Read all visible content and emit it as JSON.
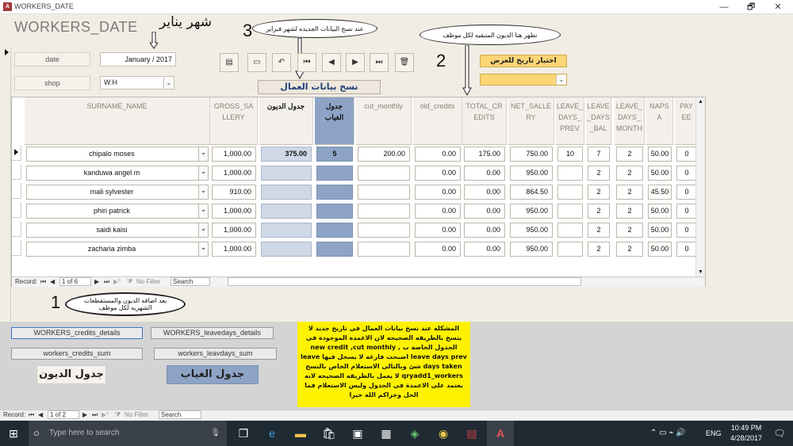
{
  "window": {
    "title": "WORKERS_DATE",
    "minimize": "—",
    "restore": "🗗",
    "close": "✕"
  },
  "header": {
    "app_title": "WORKERS_DATE",
    "month_label_ar": "شهر يناير",
    "num3": "3",
    "num2": "2",
    "num1": "1",
    "callout3": "عند نسخ البيانات الجديده لشهر فبراير",
    "callout2": "تظهر هنا الديون المتبقيه لكل موظف",
    "callout1": "بعد اضافه الديون والمستقطعات الشهريه لكل موظف"
  },
  "form": {
    "date_label": "date",
    "date_value": "January / 2017",
    "shop_label": "shop",
    "shop_value": "W.H",
    "copy_button": "نسخ بيانات العمال",
    "display_date_button": "اختيار تاريخ للعرض",
    "display_date_value": ""
  },
  "nav_icons": [
    "report-icon",
    "print-icon",
    "undo-icon",
    "first-record-icon",
    "previous-record-icon",
    "next-record-icon",
    "last-record-icon",
    "delete-icon"
  ],
  "table": {
    "columns": [
      "SURNAME_NAME",
      "GROSS_SA\nLLERY",
      "جدول الديون",
      "جدول\nالغياب",
      "cut_monthly",
      "old_credits",
      "TOTAL_CR\nEDITS",
      "NET_SALLE\nRY",
      "LEAVE_\nDAYS_\nPREV",
      "LEAVE\n_DAYS\n_BAL",
      "LEAVE_\nDAYS_\nMONTH",
      "NAPS\nA",
      "PAY\nEE"
    ],
    "rows": [
      {
        "name": "chipalo moses",
        "gross": "1,000.00",
        "credits": "375.00",
        "absence": "5",
        "cut": "200.00",
        "old": "0.00",
        "total": "175.00",
        "net": "750.00",
        "prev": "10",
        "bal": "7",
        "month": "2",
        "napsa": "50.00",
        "payee": "0"
      },
      {
        "name": "kanduwa angel m",
        "gross": "1,000.00",
        "credits": "",
        "absence": "",
        "cut": "",
        "old": "0.00",
        "total": "0.00",
        "net": "950.00",
        "prev": "",
        "bal": "2",
        "month": "2",
        "napsa": "50.00",
        "payee": "0"
      },
      {
        "name": "mali sylvester",
        "gross": "910.00",
        "credits": "",
        "absence": "",
        "cut": "",
        "old": "0.00",
        "total": "0.00",
        "net": "864.50",
        "prev": "",
        "bal": "2",
        "month": "2",
        "napsa": "45.50",
        "payee": "0"
      },
      {
        "name": "phiri patrick",
        "gross": "1,000.00",
        "credits": "",
        "absence": "",
        "cut": "",
        "old": "0.00",
        "total": "0.00",
        "net": "950.00",
        "prev": "",
        "bal": "2",
        "month": "2",
        "napsa": "50.00",
        "payee": "0"
      },
      {
        "name": "saidi kaisi",
        "gross": "1,000.00",
        "credits": "",
        "absence": "",
        "cut": "",
        "old": "0.00",
        "total": "0.00",
        "net": "950.00",
        "prev": "",
        "bal": "2",
        "month": "2",
        "napsa": "50.00",
        "payee": "0"
      },
      {
        "name": "zacharia zimba",
        "gross": "1,000.00",
        "credits": "",
        "absence": "",
        "cut": "",
        "old": "0.00",
        "total": "0.00",
        "net": "950.00",
        "prev": "",
        "bal": "2",
        "month": "2",
        "napsa": "50.00",
        "payee": "0"
      }
    ]
  },
  "subnav": {
    "record_label": "Record:",
    "position": "1 of 6",
    "filter": "No Filter",
    "search": "Search"
  },
  "lower": {
    "btn_credits_details": "WORKERS_credits_details",
    "btn_leavedays_details": "WORKERS_leavedays_details",
    "btn_credits_sum": "workers_credits_sum",
    "btn_leavdays_sum": "workers_leavdays_sum",
    "credits_table_ar": "جدول الديون",
    "absence_table_ar": "جدول الغياب",
    "note": "المشكله عند نسخ بيانات العمال فى تاريخ جديد لا ينسخ بالطريقه الصحيحه لان الاعمده الموجودة فى الجدول الخاصة ب new credit ,cut monthly , leave days prev اصبحت فارغه لا يسجل فيها leave days taken شئ وبالتالى الاستعلام الخاص بالنسخ qryadd1_workers لا يعمل بالطريقه الصحيحه لانه يعتمد على الاعمدة فى الجدول وليس الاستعلام فما الحل وجزاكم الله خيرا"
  },
  "mainnav": {
    "record_label": "Record:",
    "position": "1 of 2",
    "filter": "No Filter",
    "search": "Search"
  },
  "taskbar": {
    "search_placeholder": "Type here to search",
    "time": "10:49 PM",
    "date": "4/28/2017",
    "lang": "ENG"
  }
}
